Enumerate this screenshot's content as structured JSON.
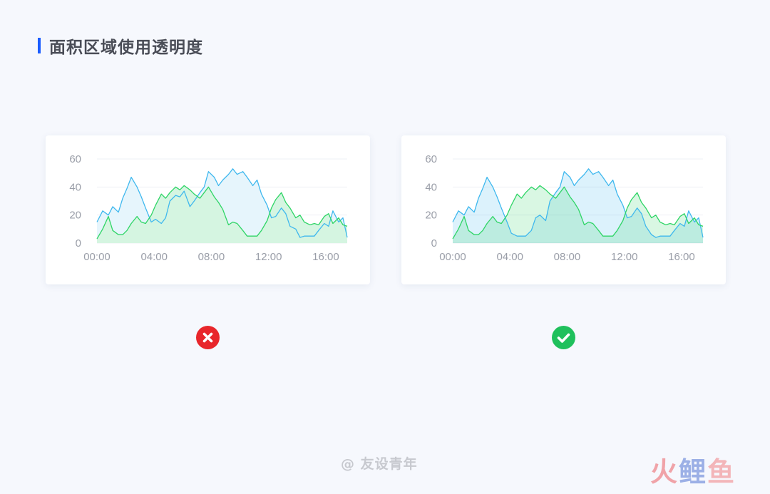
{
  "heading": {
    "title": "面积区域使用透明度"
  },
  "footer": {
    "credit": "@ 友设青年",
    "logo": [
      "火",
      "鲤",
      "鱼"
    ]
  },
  "colors": {
    "accent": "#1a5cff",
    "blue_series": "#3fb8ee",
    "green_series": "#2fd566",
    "wrong": "#e8262b",
    "right": "#1fc05c"
  },
  "badges": {
    "left": "close-icon",
    "right": "check-icon"
  },
  "chart_data": [
    {
      "type": "area",
      "note_visible": "wrong example",
      "x_ticks": [
        "00:00",
        "04:00",
        "08:00",
        "12:00",
        "16:00"
      ],
      "y_ticks": [
        "60",
        "40",
        "20",
        "0"
      ],
      "ylim": [
        0,
        60
      ],
      "xlim": [
        0,
        17.5
      ],
      "grid": true,
      "fill_opacity": 1.0,
      "series": [
        {
          "color": "#3fb8ee",
          "fill": "#e6f5fc",
          "x": [
            0,
            0.4,
            0.8,
            1.1,
            1.5,
            1.8,
            2.1,
            2.4,
            2.8,
            3.1,
            3.4,
            3.8,
            4.1,
            4.5,
            4.8,
            5.1,
            5.5,
            5.8,
            6.1,
            6.5,
            6.8,
            7.2,
            7.5,
            7.8,
            8.2,
            8.5,
            8.8,
            9.2,
            9.5,
            9.8,
            10.2,
            10.5,
            10.9,
            11.2,
            11.5,
            11.9,
            12.2,
            12.5,
            12.9,
            13.2,
            13.5,
            13.9,
            14.2,
            14.5,
            14.9,
            15.2,
            15.5,
            15.9,
            16.2,
            16.5,
            16.9,
            17.2,
            17.5
          ],
          "y": [
            15,
            23,
            20,
            26,
            22,
            32,
            39,
            47,
            40,
            33,
            25,
            15,
            17,
            14,
            18,
            30,
            34,
            33,
            37,
            26,
            30,
            36,
            40,
            51,
            47,
            41,
            45,
            49,
            53,
            49,
            51,
            47,
            41,
            45,
            35,
            27,
            18,
            19,
            25,
            21,
            12,
            10,
            4,
            5,
            5,
            5,
            9,
            14,
            12,
            23,
            15,
            18,
            4
          ]
        },
        {
          "color": "#2fd566",
          "fill": "#d5f5e1",
          "x": [
            0,
            0.4,
            0.8,
            1.1,
            1.5,
            1.8,
            2.1,
            2.4,
            2.8,
            3.1,
            3.4,
            3.8,
            4.1,
            4.5,
            4.8,
            5.1,
            5.5,
            5.8,
            6.1,
            6.5,
            6.8,
            7.2,
            7.5,
            7.8,
            8.2,
            8.5,
            8.8,
            9.2,
            9.5,
            9.8,
            10.2,
            10.5,
            10.9,
            11.2,
            11.5,
            11.9,
            12.2,
            12.5,
            12.9,
            13.2,
            13.5,
            13.9,
            14.2,
            14.5,
            14.9,
            15.2,
            15.5,
            15.9,
            16.2,
            16.5,
            16.9,
            17.2,
            17.5
          ],
          "y": [
            3,
            10,
            19,
            9,
            6,
            6,
            9,
            14,
            19,
            15,
            14,
            20,
            27,
            35,
            32,
            36,
            40,
            38,
            41,
            38,
            35,
            32,
            36,
            40,
            33,
            29,
            24,
            13,
            15,
            14,
            9,
            5,
            5,
            5,
            9,
            16,
            25,
            31,
            36,
            29,
            25,
            18,
            20,
            15,
            13,
            14,
            13,
            19,
            21,
            14,
            18,
            13,
            12
          ]
        }
      ]
    },
    {
      "type": "area",
      "note_visible": "correct example",
      "x_ticks": [
        "00:00",
        "04:00",
        "08:00",
        "12:00",
        "16:00"
      ],
      "y_ticks": [
        "60",
        "40",
        "20",
        "0"
      ],
      "ylim": [
        0,
        60
      ],
      "xlim": [
        0,
        17.5
      ],
      "grid": true,
      "fill_opacity": 0.18,
      "series": [
        {
          "color": "#3fb8ee",
          "fill": "#3fb8ee",
          "x": [
            0,
            0.4,
            0.8,
            1.1,
            1.5,
            1.8,
            2.1,
            2.4,
            2.8,
            3.1,
            3.4,
            3.8,
            4.1,
            4.5,
            4.8,
            5.1,
            5.5,
            5.8,
            6.1,
            6.5,
            6.8,
            7.2,
            7.5,
            7.8,
            8.2,
            8.5,
            8.8,
            9.2,
            9.5,
            9.8,
            10.2,
            10.5,
            10.9,
            11.2,
            11.5,
            11.9,
            12.2,
            12.5,
            12.9,
            13.2,
            13.5,
            13.9,
            14.2,
            14.5,
            14.9,
            15.2,
            15.5,
            15.9,
            16.2,
            16.5,
            16.9,
            17.2,
            17.5
          ],
          "y": [
            15,
            23,
            20,
            26,
            22,
            32,
            39,
            47,
            40,
            33,
            25,
            15,
            7,
            5,
            5,
            5,
            9,
            18,
            20,
            16,
            30,
            36,
            40,
            51,
            47,
            41,
            45,
            49,
            53,
            49,
            51,
            47,
            41,
            45,
            35,
            27,
            18,
            19,
            25,
            21,
            12,
            6,
            4,
            5,
            5,
            5,
            9,
            14,
            12,
            23,
            15,
            18,
            4
          ]
        },
        {
          "color": "#2fd566",
          "fill": "#2fd566",
          "x": [
            0,
            0.4,
            0.8,
            1.1,
            1.5,
            1.8,
            2.1,
            2.4,
            2.8,
            3.1,
            3.4,
            3.8,
            4.1,
            4.5,
            4.8,
            5.1,
            5.5,
            5.8,
            6.1,
            6.5,
            6.8,
            7.2,
            7.5,
            7.8,
            8.2,
            8.5,
            8.8,
            9.2,
            9.5,
            9.8,
            10.2,
            10.5,
            10.9,
            11.2,
            11.5,
            11.9,
            12.2,
            12.5,
            12.9,
            13.2,
            13.5,
            13.9,
            14.2,
            14.5,
            14.9,
            15.2,
            15.5,
            15.9,
            16.2,
            16.5,
            16.9,
            17.2,
            17.5
          ],
          "y": [
            3,
            10,
            19,
            9,
            6,
            6,
            9,
            14,
            19,
            15,
            14,
            20,
            27,
            35,
            32,
            36,
            40,
            38,
            41,
            38,
            35,
            32,
            36,
            40,
            33,
            29,
            24,
            13,
            15,
            14,
            9,
            5,
            5,
            5,
            9,
            16,
            25,
            31,
            36,
            29,
            25,
            18,
            20,
            15,
            13,
            14,
            13,
            19,
            21,
            14,
            18,
            13,
            12
          ]
        }
      ]
    }
  ]
}
